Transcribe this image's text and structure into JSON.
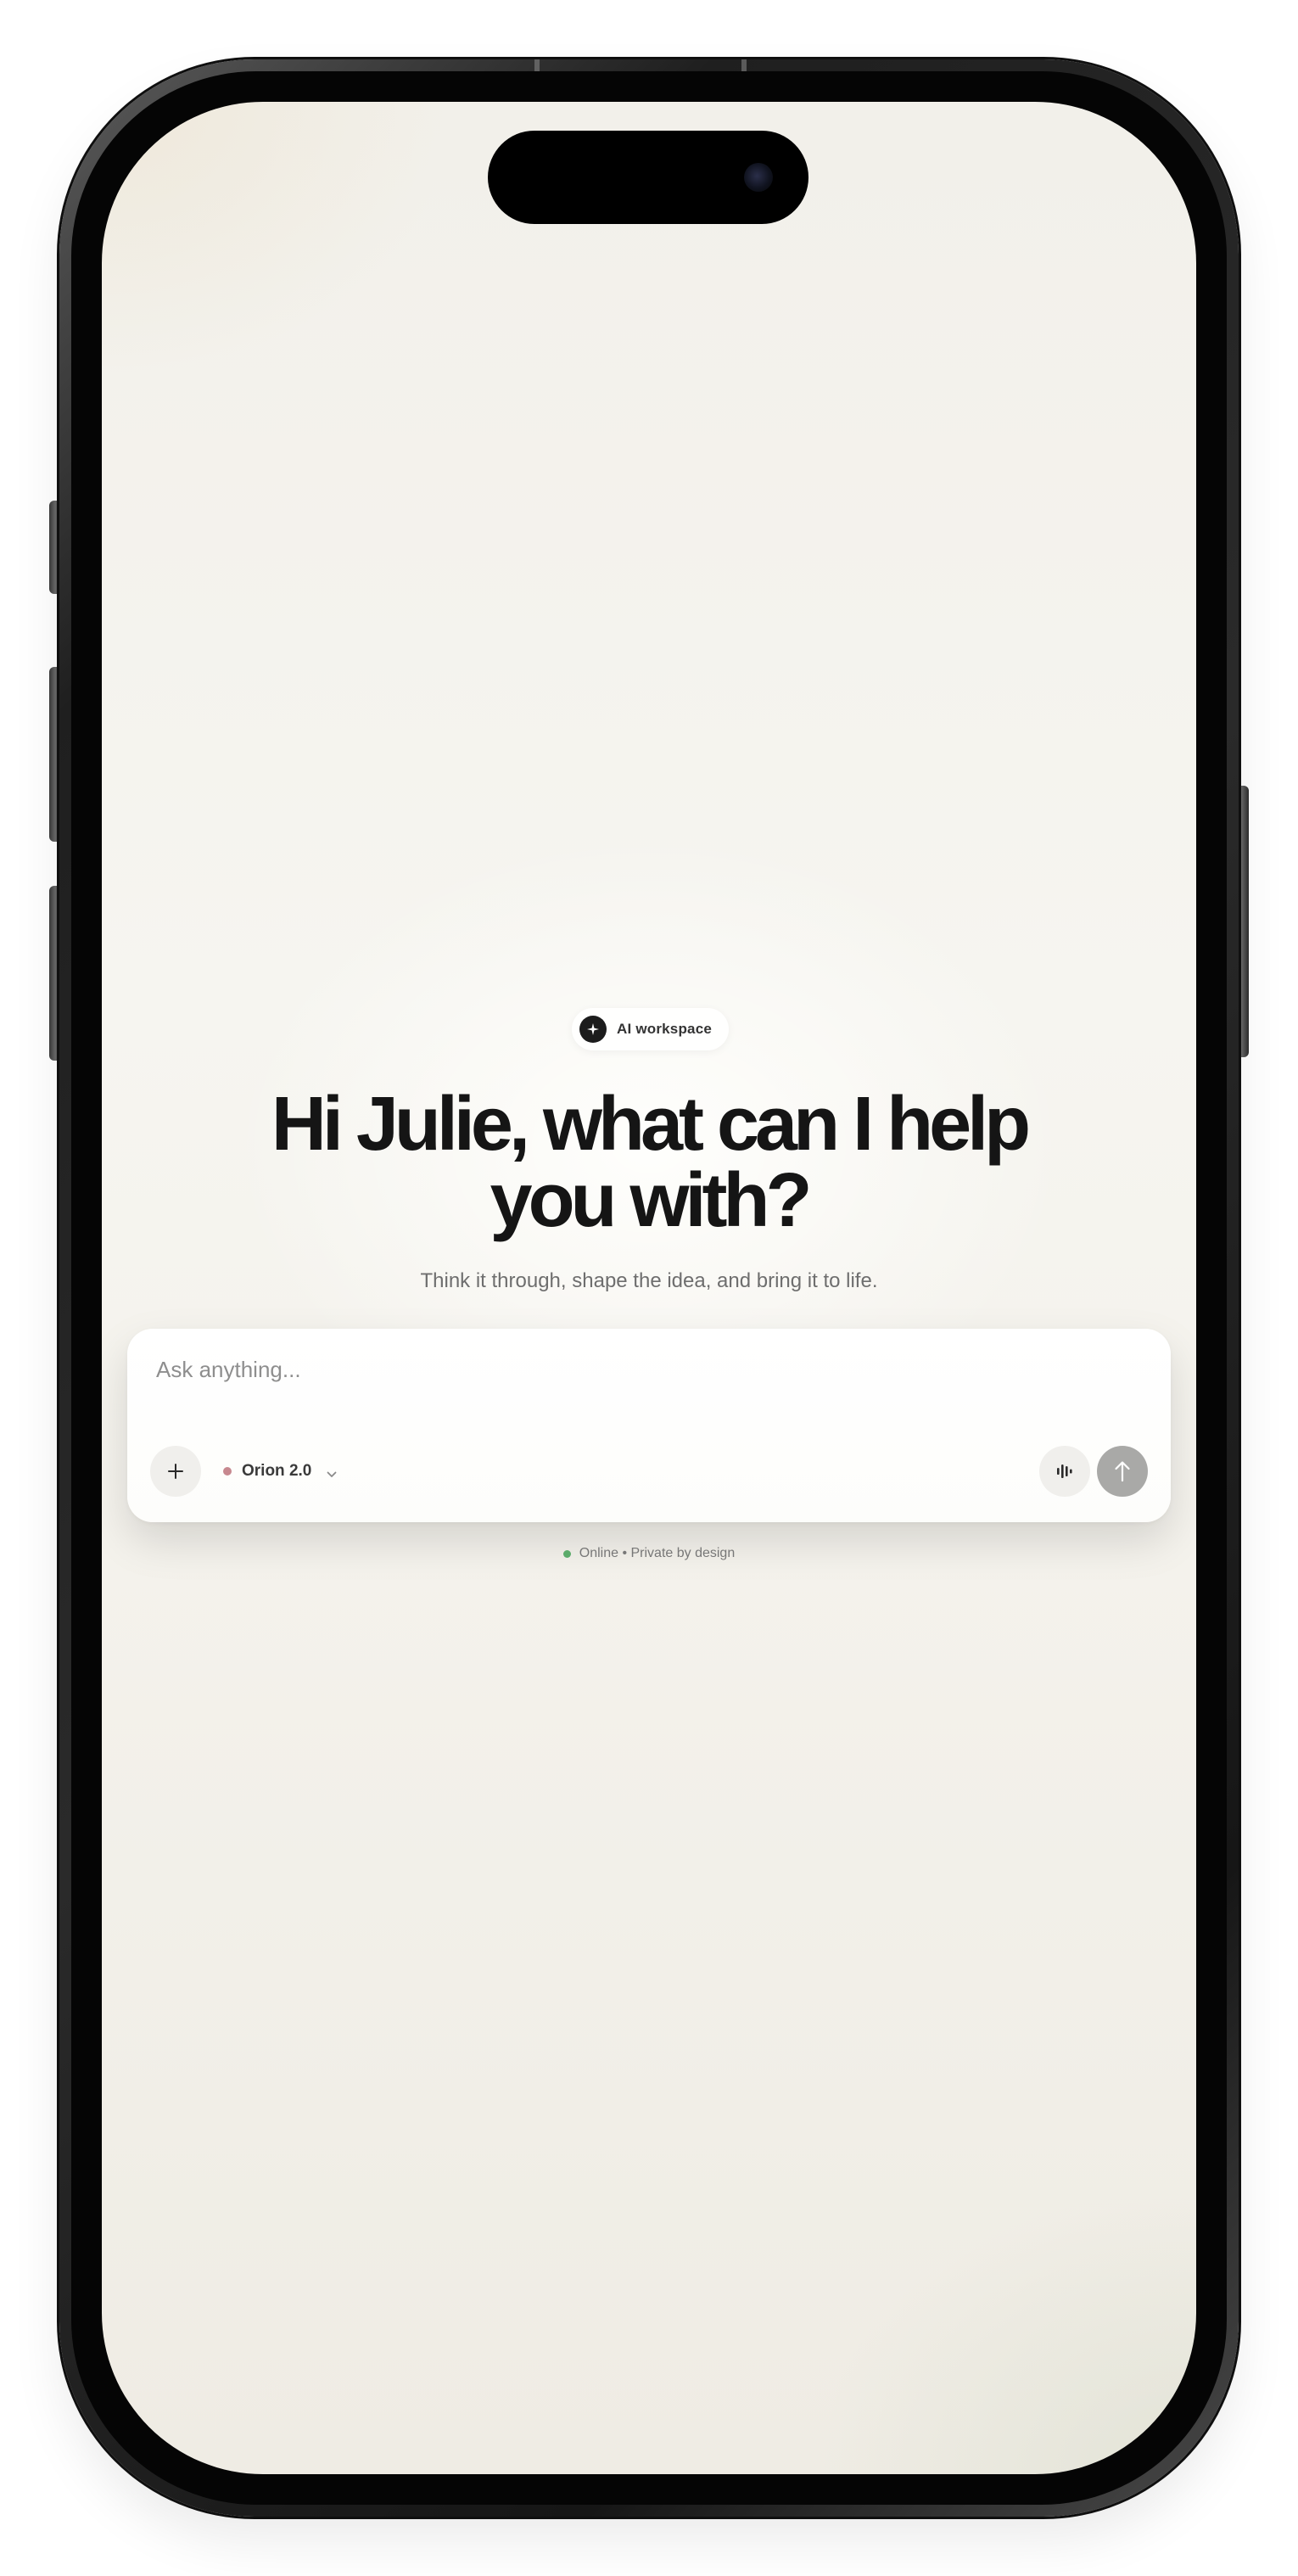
{
  "badge": {
    "icon": "sparkle-icon",
    "label": "AI workspace"
  },
  "headline": {
    "line1": "Hi Julie, what can I help",
    "line2": "you with?"
  },
  "subtitle": "Think it through, shape the idea, and bring it to life.",
  "composer": {
    "placeholder": "Ask anything...",
    "value": "",
    "add_icon": "plus-icon",
    "model": {
      "name": "Orion 2.0",
      "dot_color": "#c7888f",
      "chevron_icon": "chevron-down-icon"
    },
    "voice_icon": "waveform-icon",
    "send_icon": "arrow-up-icon"
  },
  "status": {
    "text": "Online • Private by design",
    "dot_color": "#5bab6a"
  },
  "colors": {
    "headline": "#151515",
    "send_button": "#a9a9a7",
    "background": "#f4f2ec"
  }
}
